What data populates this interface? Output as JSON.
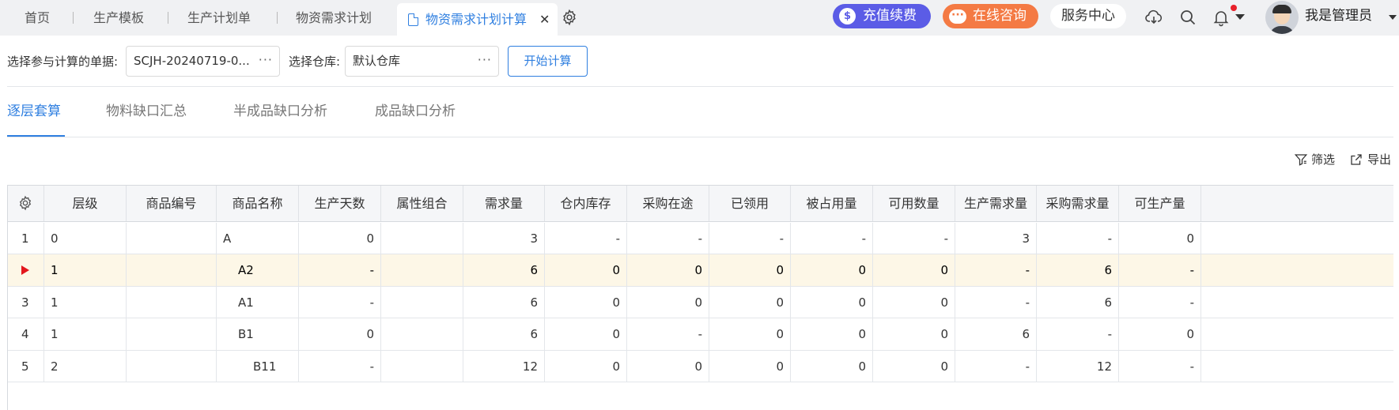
{
  "tabs": [
    {
      "label": "首页"
    },
    {
      "label": "生产模板"
    },
    {
      "label": "生产计划单"
    },
    {
      "label": "物资需求计划"
    },
    {
      "label": "物资需求计划计算",
      "active": true
    }
  ],
  "tab_close": "✕",
  "topbar": {
    "recharge": "充值续费",
    "consult": "在线咨询",
    "service": "服务中心",
    "username": "我是管理员",
    "accent_purple": "#5b5ce6",
    "accent_orange": "#f47a44"
  },
  "toolbar": {
    "doc_label": "选择参与计算的单据:",
    "doc_value": "SCJH-20240719-0...",
    "warehouse_label": "选择仓库:",
    "warehouse_value": "默认仓库",
    "ellipsis": "···",
    "calc_button": "开始计算"
  },
  "subtabs": [
    "逐层套算",
    "物料缺口汇总",
    "半成品缺口分析",
    "成品缺口分析"
  ],
  "actions": {
    "filter": "筛选",
    "export": "导出"
  },
  "table": {
    "columns": [
      "",
      "层级",
      "商品编号",
      "商品名称",
      "生产天数",
      "属性组合",
      "需求量",
      "仓内库存",
      "采购在途",
      "已领用",
      "被占用量",
      "可用数量",
      "生产需求量",
      "采购需求量",
      "可生产量"
    ],
    "rows": [
      {
        "idx": "1",
        "cells": [
          "0",
          "",
          "A",
          "0",
          "",
          "3",
          "-",
          "-",
          "-",
          "-",
          "-",
          "3",
          "-",
          "0"
        ],
        "indent": 0
      },
      {
        "idx": "",
        "selected": true,
        "cells": [
          "1",
          "",
          "A2",
          "-",
          "",
          "6",
          "0",
          "0",
          "0",
          "0",
          "0",
          "-",
          "6",
          "-"
        ],
        "indent": 1
      },
      {
        "idx": "3",
        "cells": [
          "1",
          "",
          "A1",
          "-",
          "",
          "6",
          "0",
          "0",
          "0",
          "0",
          "0",
          "-",
          "6",
          "-"
        ],
        "indent": 1
      },
      {
        "idx": "4",
        "cells": [
          "1",
          "",
          "B1",
          "0",
          "",
          "6",
          "0",
          "-",
          "0",
          "0",
          "0",
          "6",
          "-",
          "0"
        ],
        "indent": 1
      },
      {
        "idx": "5",
        "cells": [
          "2",
          "",
          "B11",
          "-",
          "",
          "12",
          "0",
          "0",
          "0",
          "0",
          "0",
          "-",
          "12",
          "-"
        ],
        "indent": 2
      }
    ]
  }
}
